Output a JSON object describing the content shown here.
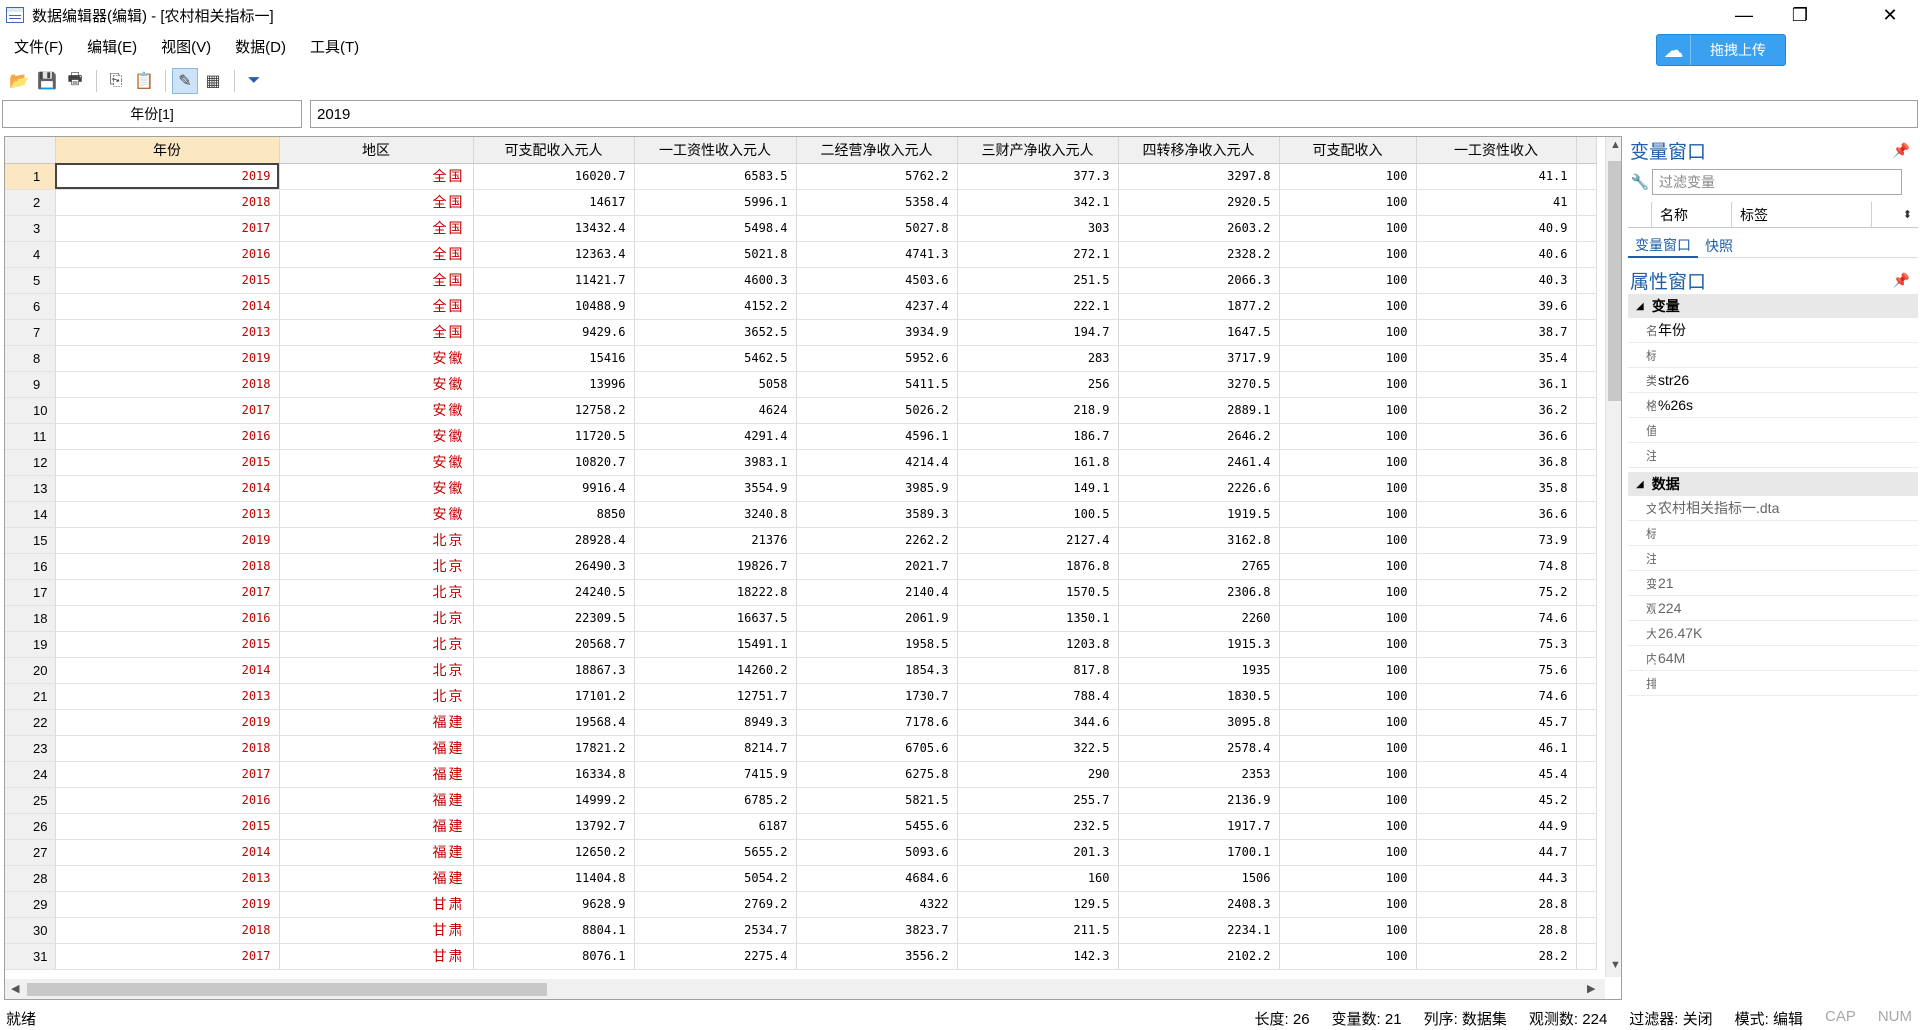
{
  "window": {
    "title": "数据编辑器(编辑) - [农村相关指标一]",
    "minimize": "—",
    "restore": "❐",
    "close": "✕"
  },
  "menu": [
    "文件(F)",
    "编辑(E)",
    "视图(V)",
    "数据(D)",
    "工具(T)"
  ],
  "upload_button": "拖拽上传",
  "editbar": {
    "varname": "年份[1]",
    "value": "2019"
  },
  "columns": [
    "年份",
    "地区",
    "可支配收入元人",
    "一工资性收入元人",
    "二经营净收入元人",
    "三财产净收入元人",
    "四转移净收入元人",
    "可支配收入",
    "一工资性收入"
  ],
  "rows": [
    [
      1,
      "2019",
      "全国",
      "16020.7",
      "6583.5",
      "5762.2",
      "377.3",
      "3297.8",
      "100",
      "41.1"
    ],
    [
      2,
      "2018",
      "全国",
      "14617",
      "5996.1",
      "5358.4",
      "342.1",
      "2920.5",
      "100",
      "41"
    ],
    [
      3,
      "2017",
      "全国",
      "13432.4",
      "5498.4",
      "5027.8",
      "303",
      "2603.2",
      "100",
      "40.9"
    ],
    [
      4,
      "2016",
      "全国",
      "12363.4",
      "5021.8",
      "4741.3",
      "272.1",
      "2328.2",
      "100",
      "40.6"
    ],
    [
      5,
      "2015",
      "全国",
      "11421.7",
      "4600.3",
      "4503.6",
      "251.5",
      "2066.3",
      "100",
      "40.3"
    ],
    [
      6,
      "2014",
      "全国",
      "10488.9",
      "4152.2",
      "4237.4",
      "222.1",
      "1877.2",
      "100",
      "39.6"
    ],
    [
      7,
      "2013",
      "全国",
      "9429.6",
      "3652.5",
      "3934.9",
      "194.7",
      "1647.5",
      "100",
      "38.7"
    ],
    [
      8,
      "2019",
      "安徽",
      "15416",
      "5462.5",
      "5952.6",
      "283",
      "3717.9",
      "100",
      "35.4"
    ],
    [
      9,
      "2018",
      "安徽",
      "13996",
      "5058",
      "5411.5",
      "256",
      "3270.5",
      "100",
      "36.1"
    ],
    [
      10,
      "2017",
      "安徽",
      "12758.2",
      "4624",
      "5026.2",
      "218.9",
      "2889.1",
      "100",
      "36.2"
    ],
    [
      11,
      "2016",
      "安徽",
      "11720.5",
      "4291.4",
      "4596.1",
      "186.7",
      "2646.2",
      "100",
      "36.6"
    ],
    [
      12,
      "2015",
      "安徽",
      "10820.7",
      "3983.1",
      "4214.4",
      "161.8",
      "2461.4",
      "100",
      "36.8"
    ],
    [
      13,
      "2014",
      "安徽",
      "9916.4",
      "3554.9",
      "3985.9",
      "149.1",
      "2226.6",
      "100",
      "35.8"
    ],
    [
      14,
      "2013",
      "安徽",
      "8850",
      "3240.8",
      "3589.3",
      "100.5",
      "1919.5",
      "100",
      "36.6"
    ],
    [
      15,
      "2019",
      "北京",
      "28928.4",
      "21376",
      "2262.2",
      "2127.4",
      "3162.8",
      "100",
      "73.9"
    ],
    [
      16,
      "2018",
      "北京",
      "26490.3",
      "19826.7",
      "2021.7",
      "1876.8",
      "2765",
      "100",
      "74.8"
    ],
    [
      17,
      "2017",
      "北京",
      "24240.5",
      "18222.8",
      "2140.4",
      "1570.5",
      "2306.8",
      "100",
      "75.2"
    ],
    [
      18,
      "2016",
      "北京",
      "22309.5",
      "16637.5",
      "2061.9",
      "1350.1",
      "2260",
      "100",
      "74.6"
    ],
    [
      19,
      "2015",
      "北京",
      "20568.7",
      "15491.1",
      "1958.5",
      "1203.8",
      "1915.3",
      "100",
      "75.3"
    ],
    [
      20,
      "2014",
      "北京",
      "18867.3",
      "14260.2",
      "1854.3",
      "817.8",
      "1935",
      "100",
      "75.6"
    ],
    [
      21,
      "2013",
      "北京",
      "17101.2",
      "12751.7",
      "1730.7",
      "788.4",
      "1830.5",
      "100",
      "74.6"
    ],
    [
      22,
      "2019",
      "福建",
      "19568.4",
      "8949.3",
      "7178.6",
      "344.6",
      "3095.8",
      "100",
      "45.7"
    ],
    [
      23,
      "2018",
      "福建",
      "17821.2",
      "8214.7",
      "6705.6",
      "322.5",
      "2578.4",
      "100",
      "46.1"
    ],
    [
      24,
      "2017",
      "福建",
      "16334.8",
      "7415.9",
      "6275.8",
      "290",
      "2353",
      "100",
      "45.4"
    ],
    [
      25,
      "2016",
      "福建",
      "14999.2",
      "6785.2",
      "5821.5",
      "255.7",
      "2136.9",
      "100",
      "45.2"
    ],
    [
      26,
      "2015",
      "福建",
      "13792.7",
      "6187",
      "5455.6",
      "232.5",
      "1917.7",
      "100",
      "44.9"
    ],
    [
      27,
      "2014",
      "福建",
      "12650.2",
      "5655.2",
      "5093.6",
      "201.3",
      "1700.1",
      "100",
      "44.7"
    ],
    [
      28,
      "2013",
      "福建",
      "11404.8",
      "5054.2",
      "4684.6",
      "160",
      "1506",
      "100",
      "44.3"
    ],
    [
      29,
      "2019",
      "甘肃",
      "9628.9",
      "2769.2",
      "4322",
      "129.5",
      "2408.3",
      "100",
      "28.8"
    ],
    [
      30,
      "2018",
      "甘肃",
      "8804.1",
      "2534.7",
      "3823.7",
      "211.5",
      "2234.1",
      "100",
      "28.8"
    ],
    [
      31,
      "2017",
      "甘肃",
      "8076.1",
      "2275.4",
      "3556.2",
      "142.3",
      "2102.2",
      "100",
      "28.2"
    ]
  ],
  "variables_panel": {
    "title": "变量窗口",
    "filter_placeholder": "过滤变量",
    "col_name": "名称",
    "col_label": "标签",
    "tabs": [
      "变量窗口",
      "快照"
    ]
  },
  "properties_panel": {
    "title": "属性窗口",
    "section_variable": "变量",
    "var_rows": [
      {
        "key": "名",
        "value": "年份"
      },
      {
        "key": "标",
        "value": ""
      },
      {
        "key": "类",
        "value": "str26"
      },
      {
        "key": "格",
        "value": "%26s"
      },
      {
        "key": "值",
        "value": ""
      },
      {
        "key": "注",
        "value": ""
      }
    ],
    "section_data": "数据",
    "data_rows": [
      {
        "key": "文",
        "value": "农村相关指标一.dta"
      },
      {
        "key": "标",
        "value": ""
      },
      {
        "key": "注",
        "value": ""
      },
      {
        "key": "变",
        "value": "21"
      },
      {
        "key": "观",
        "value": "224"
      },
      {
        "key": "大",
        "value": "26.47K"
      },
      {
        "key": "内",
        "value": "64M"
      },
      {
        "key": "排",
        "value": ""
      }
    ]
  },
  "status": {
    "left": "就绪",
    "length": "长度: 26",
    "vars": "变量数: 21",
    "order": "列序: 数据集",
    "obs": "观测数: 224",
    "filter": "过滤器: 关闭",
    "mode": "模式: 编辑",
    "cap": "CAP",
    "num": "NUM"
  },
  "colors": {
    "accent": "#1f5fa8",
    "string_text": "#c00000",
    "selected_header": "#fbe8c2",
    "upload_button": "#3aa0f0"
  }
}
